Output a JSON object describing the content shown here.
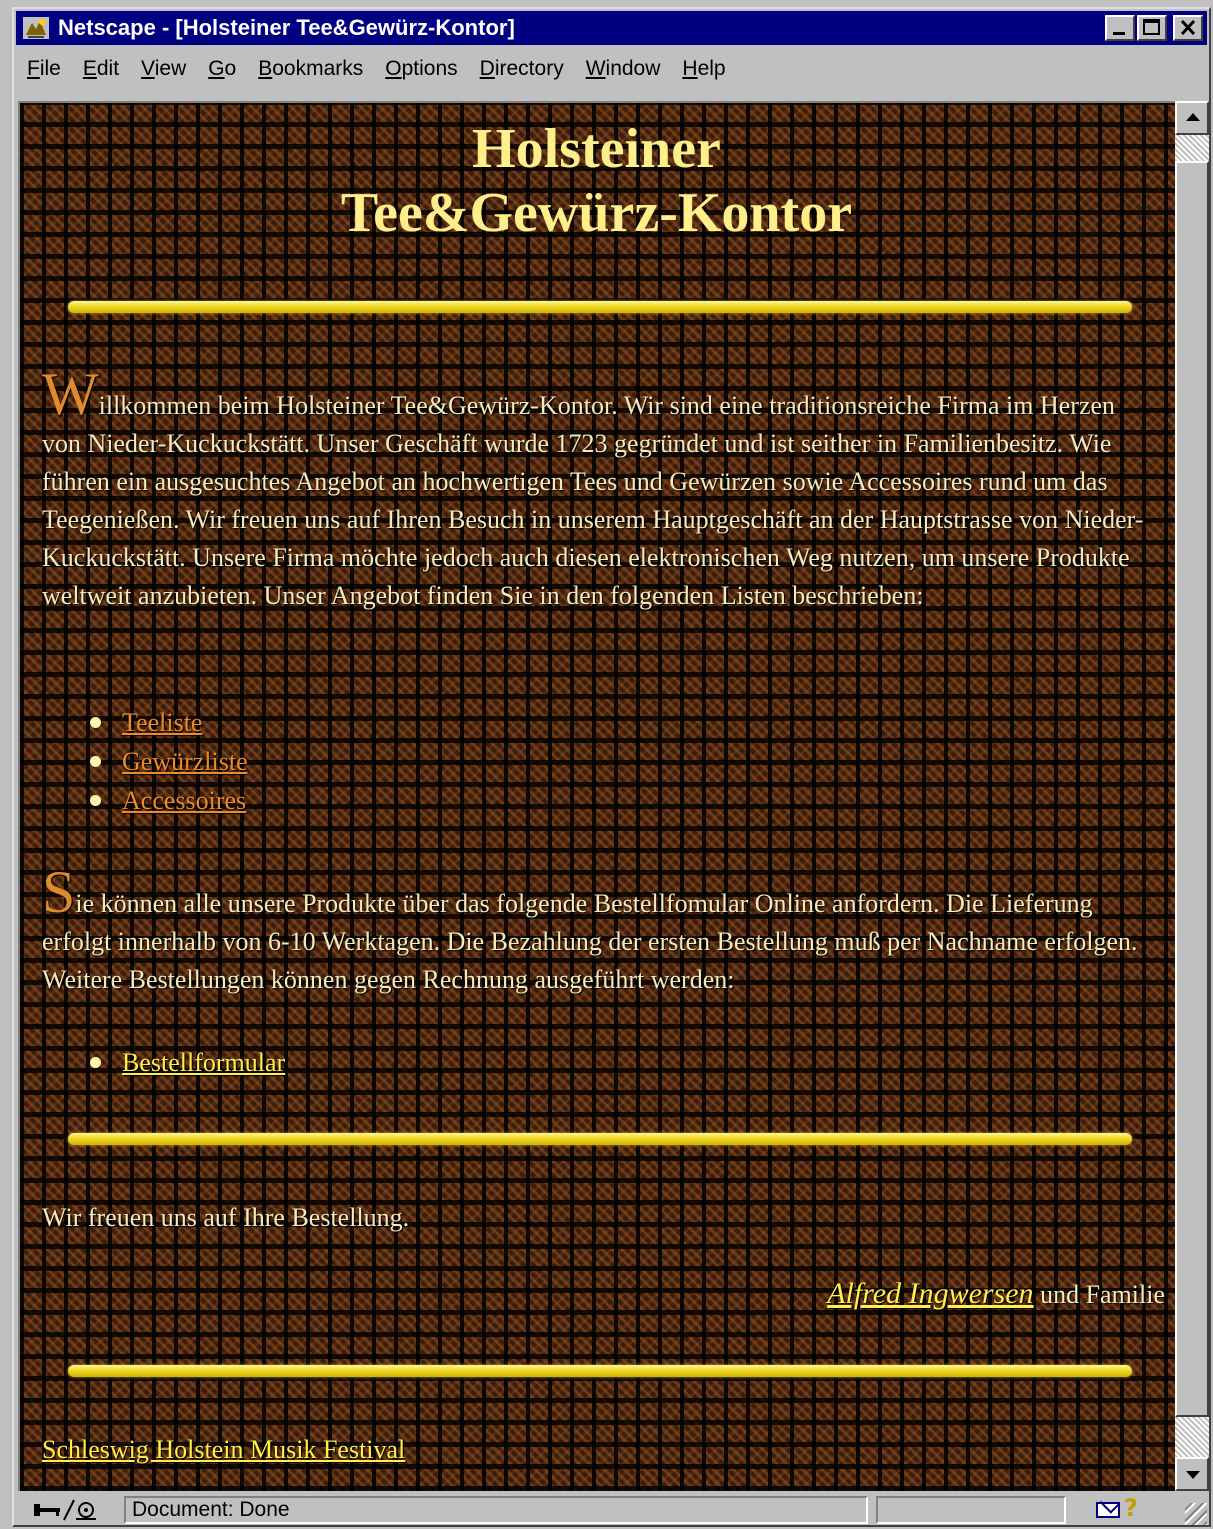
{
  "window": {
    "title": "Netscape - [Holsteiner Tee&Gewürz-Kontor]"
  },
  "menu": [
    {
      "label": "File",
      "mnemonic": "F",
      "rest": "ile"
    },
    {
      "label": "Edit",
      "mnemonic": "E",
      "rest": "dit"
    },
    {
      "label": "View",
      "mnemonic": "V",
      "rest": "iew"
    },
    {
      "label": "Go",
      "mnemonic": "G",
      "rest": "o"
    },
    {
      "label": "Bookmarks",
      "mnemonic": "B",
      "rest": "ookmarks"
    },
    {
      "label": "Options",
      "mnemonic": "O",
      "rest": "ptions"
    },
    {
      "label": "Directory",
      "mnemonic": "D",
      "rest": "irectory"
    },
    {
      "label": "Window",
      "mnemonic": "W",
      "rest": "indow"
    },
    {
      "label": "Help",
      "mnemonic": "H",
      "rest": "elp"
    }
  ],
  "page": {
    "title_line1": "Holsteiner",
    "title_line2": "Tee&Gewürz-Kontor",
    "intro_dropcap": "W",
    "intro_text": "illkommen beim Holsteiner Tee&Gewürz-Kontor. Wir sind eine traditionsreiche Firma im Herzen von Nieder-Kuckuckstätt. Unser Geschäft wurde 1723 gegründet und ist seither in Familienbesitz. Wie führen ein ausgesuchtes Angebot an hochwertigen Tees und Gewürzen sowie Accessoires rund um das Teegenießen. Wir freuen uns auf Ihren Besuch in unserem Hauptgeschäft an der Hauptstrasse von Nieder-Kuckuckstätt. Unsere Firma möchte jedoch auch diesen elektronischen Weg nutzen, um unsere Produkte weltweit anzubieten. Unser Angebot finden Sie in den folgenden Listen beschrieben:",
    "product_links": [
      "Teeliste",
      "Gewürzliste",
      "Accessoires"
    ],
    "order_dropcap": "S",
    "order_text": "ie können alle unsere Produkte über das folgende Bestellfomular Online anfordern. Die Lieferung erfolgt innerhalb von 6-10 Werktagen. Die Bezahlung der ersten Bestellung muß per Nachname erfolgen. Weitere Bestellungen können gegen Rechnung ausgeführt werden:",
    "order_link": "Bestellformular",
    "closing_text": "Wir freuen uns auf Ihre Bestellung.",
    "signature_name": "Alfred Ingwersen",
    "signature_rest": " und Familie",
    "footer_link": "Schleswig Holstein Musik Festival"
  },
  "status": {
    "text": "Document: Done"
  },
  "colors": {
    "titlebar": "#000080",
    "heading": "#ffef8a",
    "body_text": "#f4ebbf",
    "link_orange": "#ee8a2a",
    "link_yellow": "#fff04a",
    "rule": "#f2dc2a"
  },
  "icons": [
    "netscape-app-icon",
    "minimize-icon",
    "maximize-icon",
    "close-icon",
    "scroll-up-icon",
    "scroll-down-icon",
    "security-key-icon",
    "mail-icon",
    "help-question-icon",
    "resize-grip-icon"
  ]
}
